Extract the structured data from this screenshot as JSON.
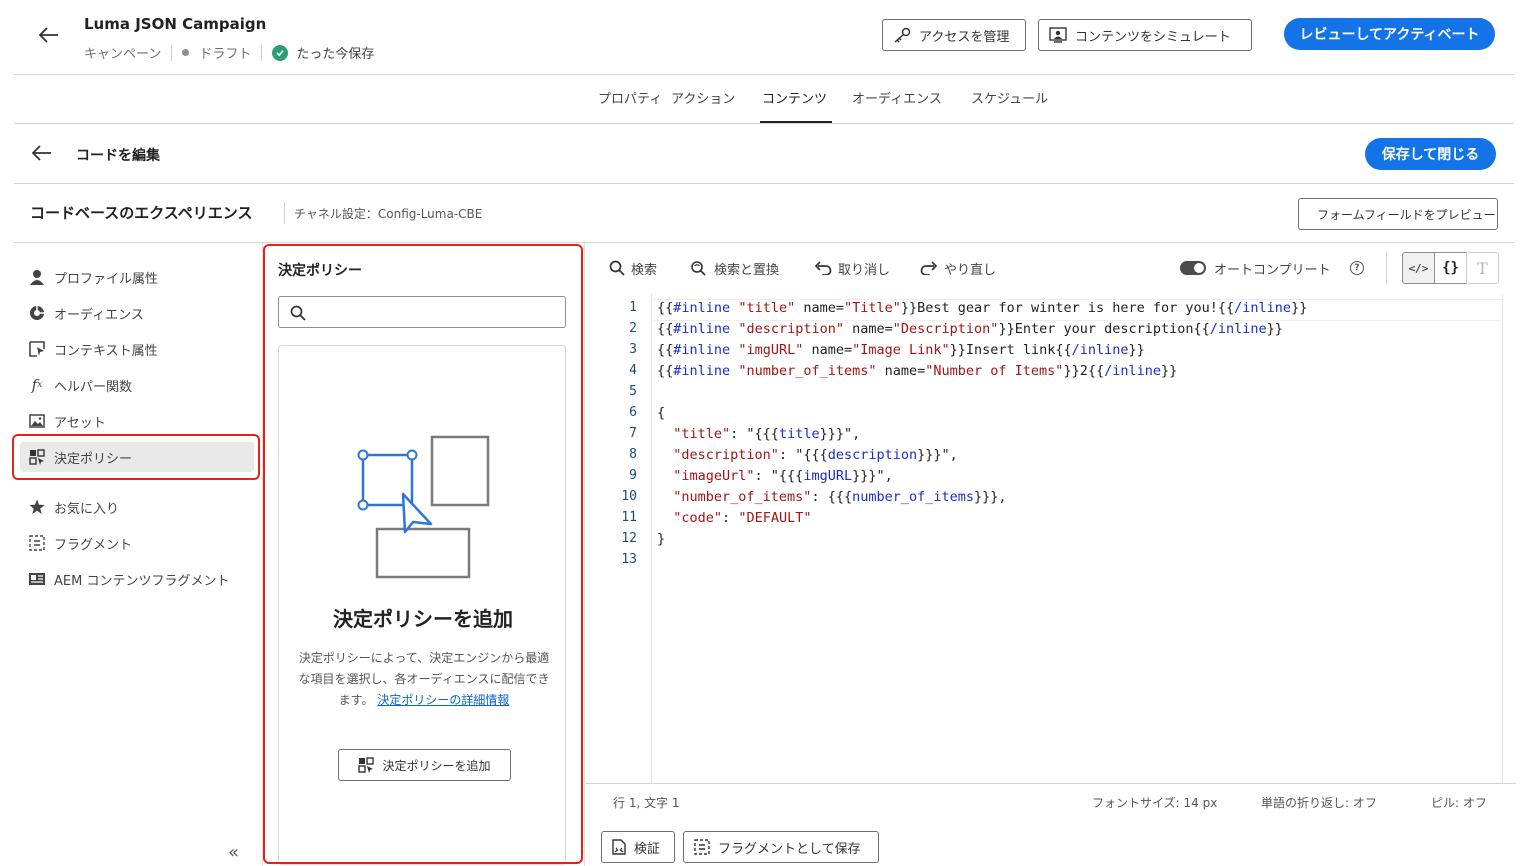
{
  "header": {
    "campaign_title": "Luma JSON Campaign",
    "type": "キャンペーン",
    "status": "ドラフト",
    "saved": "たった今保存",
    "manage_access": "アクセスを管理",
    "simulate": "コンテンツをシミュレート",
    "review_activate": "レビューしてアクティベート"
  },
  "tabs": [
    "プロパティ",
    "アクション",
    "コンテンツ",
    "オーディエンス",
    "スケジュール"
  ],
  "active_tab": "コンテンツ",
  "edit_bar": {
    "title": "コードを編集",
    "save_close": "保存して閉じる"
  },
  "cbe": {
    "title": "コードベースのエクスペリエンス",
    "channel": "チャネル設定：Config-Luma-CBE",
    "preview_form": "フォームフィールドをプレビュー"
  },
  "sidebar": {
    "items": [
      {
        "label": "プロファイル属性",
        "icon": "person-icon"
      },
      {
        "label": "オーディエンス",
        "icon": "audience-icon"
      },
      {
        "label": "コンテキスト属性",
        "icon": "context-icon"
      },
      {
        "label": "ヘルパー関数",
        "icon": "function-icon"
      },
      {
        "label": "アセット",
        "icon": "image-icon"
      },
      {
        "label": "決定ポリシー",
        "icon": "decision-icon"
      },
      {
        "label": "お気に入り",
        "icon": "star-icon"
      },
      {
        "label": "フラグメント",
        "icon": "fragment-icon"
      },
      {
        "label": "AEM コンテンツフラグメント",
        "icon": "aem-icon"
      }
    ],
    "active": "決定ポリシー",
    "collapse": "«"
  },
  "panel": {
    "title": "決定ポリシー",
    "search_placeholder": "",
    "card_title": "決定ポリシーを追加",
    "card_desc": "決定ポリシーによって、決定エンジンから最適な項目を選択し、各オーディエンスに配信できます。",
    "card_link": "決定ポリシーの詳細情報",
    "card_button": "決定ポリシーを追加"
  },
  "toolbar": {
    "search": "検索",
    "replace": "検索と置換",
    "undo": "取り消し",
    "redo": "やり直し",
    "autocomplete": "オートコンプリート",
    "autocomplete_on": true
  },
  "editor": {
    "line_numbers": [
      "1",
      "2",
      "3",
      "4",
      "5",
      "6",
      "7",
      "8",
      "9",
      "10",
      "11",
      "12",
      "13"
    ],
    "lines": [
      "{{#inline \"title\" name=\"Title\"}}Best gear for winter is here for you!{{/inline}}",
      "{{#inline \"description\" name=\"Description\"}}Enter your description{{/inline}}",
      "{{#inline \"imgURL\" name=\"Image Link\"}}Insert link{{/inline}}",
      "{{#inline \"number_of_items\" name=\"Number of Items\"}}2{{/inline}}",
      "",
      "{",
      "  \"title\": \"{{{title}}}\",",
      "  \"description\": \"{{{description}}}\",",
      "  \"imageUrl\": \"{{{imgURL}}}\",",
      "  \"number_of_items\": {{{number_of_items}}},",
      "  \"code\": \"DEFAULT\"",
      "}",
      ""
    ]
  },
  "status": {
    "position": "行 1, 文字 1",
    "font_size": "フォントサイズ: 14 px",
    "word_wrap": "単語の折り返し: オフ",
    "pill": "ピル: オフ"
  },
  "footer": {
    "validate": "検証",
    "save_fragment": "フラグメントとして保存"
  },
  "colors": {
    "accent": "#1473e6",
    "highlight": "#e5231b",
    "success": "#2d9d78"
  }
}
